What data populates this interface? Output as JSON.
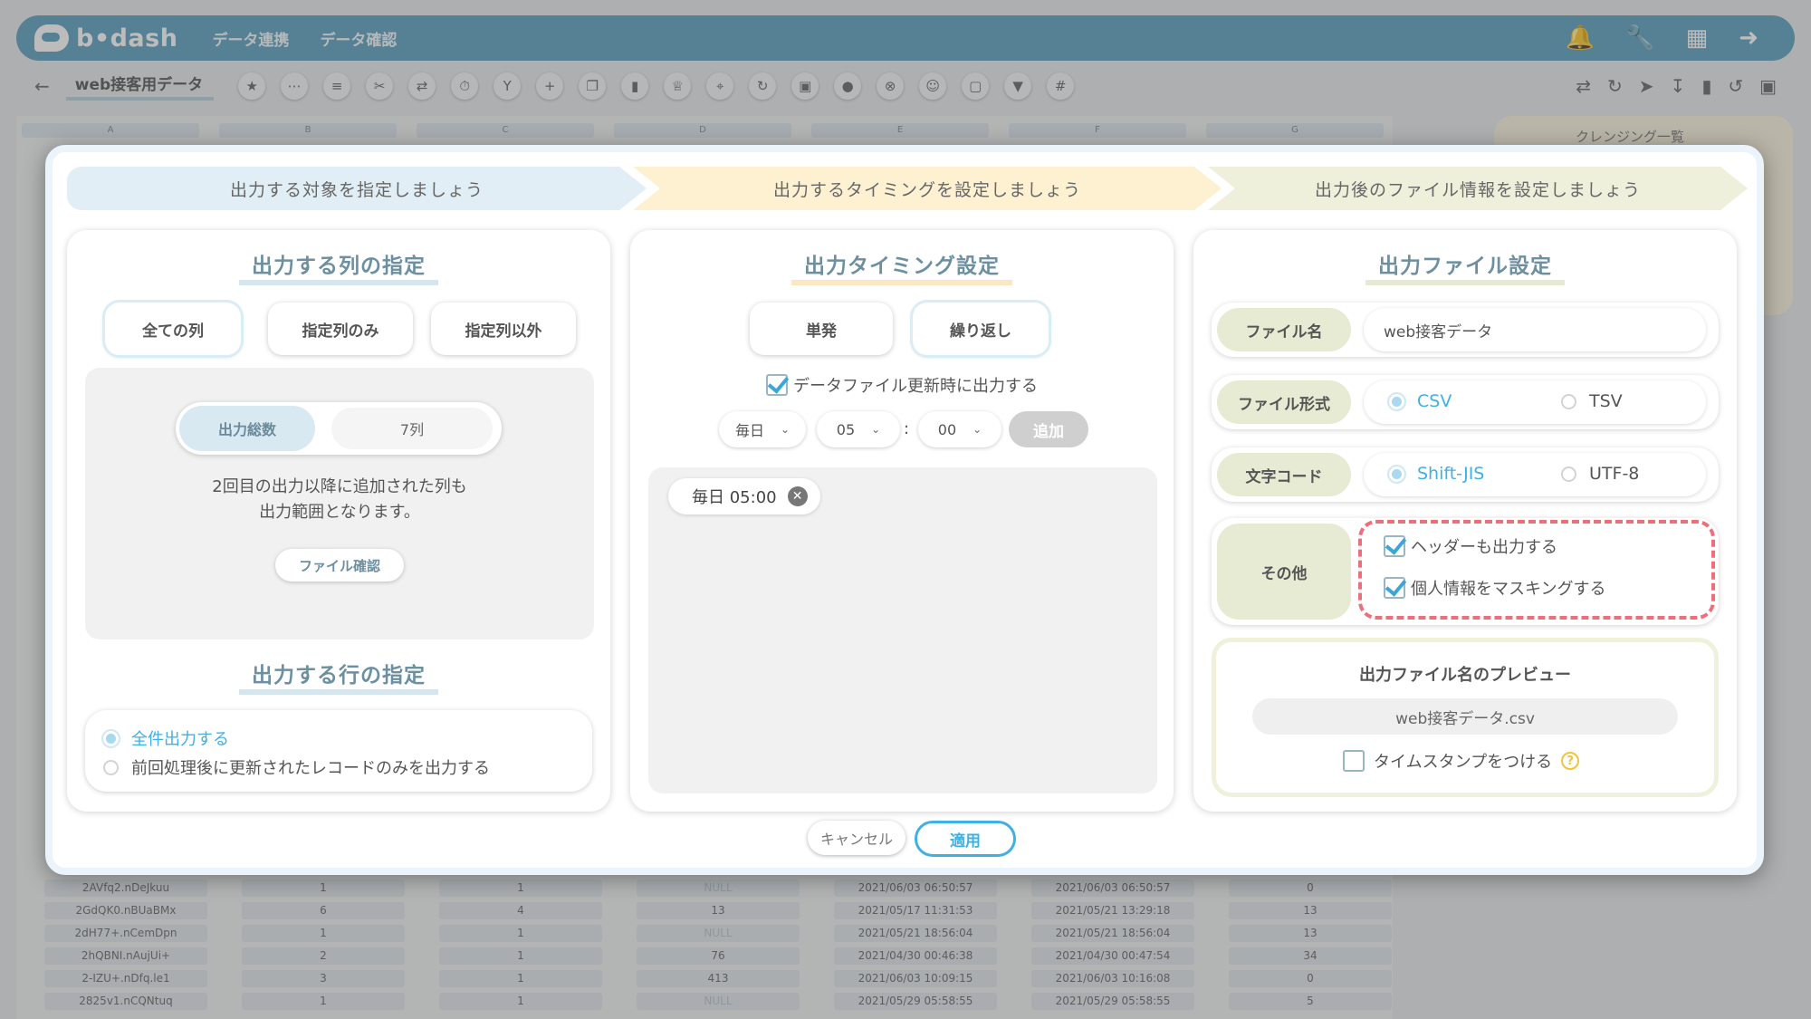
{
  "app": {
    "logo": "b•dash",
    "nav": [
      "データ連携",
      "データ確認"
    ]
  },
  "toolbar": {
    "back_icon": "arrow-left-icon",
    "title": "web接客用データ",
    "tools": [
      "star-icon",
      "ellipsis-icon",
      "list-icon",
      "scissors-icon",
      "merge-icon",
      "timer-icon",
      "branch-icon",
      "plus-icon",
      "copy-icon",
      "trash-icon",
      "crown-icon",
      "expand-icon",
      "loop-icon",
      "lock-icon",
      "bag-icon",
      "close-circle-icon",
      "face-icon",
      "square-icon",
      "filter-icon",
      "grid-icon"
    ]
  },
  "sheet": {
    "columns": [
      "A",
      "B",
      "C",
      "D",
      "E",
      "F",
      "G"
    ],
    "rows": [
      [
        "2AVfq2.nDeJkuu",
        "1",
        "1",
        "NULL",
        "2021/06/03 06:50:57",
        "2021/06/03 06:50:57",
        "0"
      ],
      [
        "2GdQK0.nBUaBMx",
        "6",
        "4",
        "13",
        "2021/05/17 11:31:53",
        "2021/05/21 13:29:18",
        "13"
      ],
      [
        "2dH77+.nCemDpn",
        "1",
        "1",
        "NULL",
        "2021/05/21 18:56:04",
        "2021/05/21 18:56:04",
        "13"
      ],
      [
        "2hQBNI.nAujUi+",
        "2",
        "1",
        "76",
        "2021/04/30 00:46:38",
        "2021/04/30 00:47:54",
        "34"
      ],
      [
        "2-IZU+.nDfq.le1",
        "3",
        "1",
        "413",
        "2021/06/03 10:09:15",
        "2021/06/03 10:16:08",
        "0"
      ],
      [
        "2825v1.nCQNtuq",
        "1",
        "1",
        "NULL",
        "2021/05/29 05:58:55",
        "2021/05/29 05:58:55",
        "5"
      ]
    ],
    "side_panel_label": "クレンジング一覧"
  },
  "steps": [
    "出力する対象を指定しましょう",
    "出力するタイミングを設定しましょう",
    "出力後のファイル情報を設定しましょう"
  ],
  "columns_card": {
    "title": "出力する列の指定",
    "options": [
      "全ての列",
      "指定列のみ",
      "指定列以外"
    ],
    "selected": "全ての列",
    "count_label": "出力総数",
    "count_value": "7列",
    "note_line1": "2回目の出力以降に追加された列も",
    "note_line2": "出力範囲となります。",
    "file_check_button": "ファイル確認",
    "rows_title": "出力する行の指定",
    "row_options": [
      "全件出力する",
      "前回処理後に更新されたレコードのみを出力する"
    ],
    "row_selected": "全件出力する"
  },
  "timing_card": {
    "title": "出力タイミング設定",
    "options": [
      "単発",
      "繰り返し"
    ],
    "selected": "繰り返し",
    "update_checkbox_label": "データファイル更新時に出力する",
    "update_checked": true,
    "frequency": "毎日",
    "hour": "05",
    "colon": ":",
    "minute": "00",
    "add_button": "追加",
    "schedules": [
      "毎日 05:00"
    ]
  },
  "file_card": {
    "title": "出力ファイル設定",
    "filename_label": "ファイル名",
    "filename_value": "web接客データ",
    "format_label": "ファイル形式",
    "format_options": [
      "CSV",
      "TSV"
    ],
    "format_selected": "CSV",
    "encoding_label": "文字コード",
    "encoding_options": [
      "Shift-JIS",
      "UTF-8"
    ],
    "encoding_selected": "Shift-JIS",
    "other_label": "その他",
    "header_label": "ヘッダーも出力する",
    "header_checked": true,
    "mask_label": "個人情報をマスキングする",
    "mask_checked": true,
    "preview_title": "出力ファイル名のプレビュー",
    "preview_name": "web接客データ.csv",
    "timestamp_label": "タイムスタンプをつける",
    "timestamp_checked": false,
    "help_icon": "question-icon"
  },
  "footer": {
    "cancel": "キャンセル",
    "apply": "適用"
  },
  "colors": {
    "brand": "#5b9fbe",
    "accent": "#3fb0e3",
    "highlight_dash": "#ef6e7b"
  }
}
